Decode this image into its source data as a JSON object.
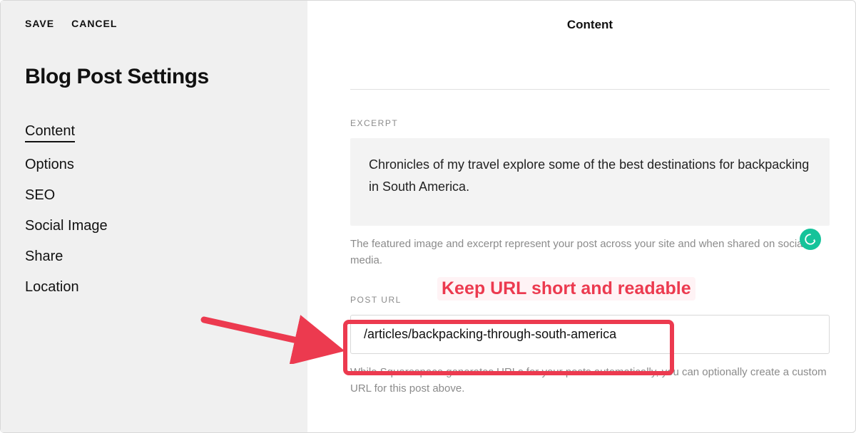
{
  "topbar": {
    "save_label": "SAVE",
    "cancel_label": "CANCEL"
  },
  "sidebar": {
    "title": "Blog Post Settings",
    "nav_items": [
      {
        "label": "Content",
        "active": true
      },
      {
        "label": "Options",
        "active": false
      },
      {
        "label": "SEO",
        "active": false
      },
      {
        "label": "Social Image",
        "active": false
      },
      {
        "label": "Share",
        "active": false
      },
      {
        "label": "Location",
        "active": false
      }
    ]
  },
  "main": {
    "title": "Content",
    "excerpt": {
      "label": "EXCERPT",
      "value": "Chronicles of my travel explore some of the best destinations for backpacking in South America.",
      "helper": "The featured image and excerpt represent your post across your site and when shared on social media."
    },
    "post_url": {
      "label": "POST URL",
      "value": "/articles/backpacking-through-south-america",
      "helper": "While Squarespace generates URLs for your posts automatically, you can optionally create a custom URL for this post above."
    }
  },
  "annotation": {
    "text": "Keep URL short and readable"
  },
  "icons": {
    "grammarly": "G"
  }
}
